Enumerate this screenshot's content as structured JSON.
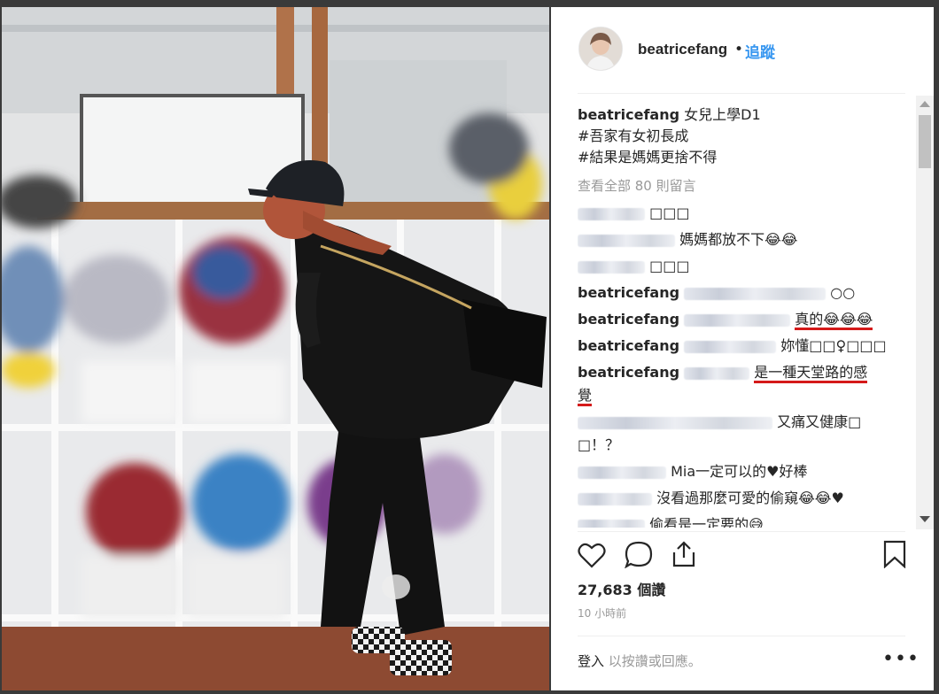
{
  "post": {
    "username": "beatricefang",
    "separator": "•",
    "follow_label": "追蹤",
    "caption_text": "女兒上學D1",
    "caption_tag1": "#吾家有女初長成",
    "caption_tag2": "#結果是媽媽更捨不得",
    "view_all": "查看全部 80 則留言",
    "likes": "27,683 個讚",
    "time": "10 小時前",
    "login_link": "登入",
    "login_text": " 以按讚或回應。",
    "more": "•••"
  },
  "comments": [
    {
      "user": "",
      "text": "□□□"
    },
    {
      "user": "",
      "text": "媽媽都放不下😂😂"
    },
    {
      "user": "",
      "text": "□□□"
    },
    {
      "user": "beatricefang",
      "text": "○○"
    },
    {
      "user": "beatricefang",
      "text": "真的😂😂😂"
    },
    {
      "user": "beatricefang",
      "text": "妳懂□□♀□□□"
    },
    {
      "user": "beatricefang",
      "text": "是一種天堂路的感"
    },
    {
      "user": "",
      "text": "覺"
    },
    {
      "user": "",
      "text": "又痛又健康□"
    },
    {
      "user": "",
      "text": "□！？"
    },
    {
      "user": "",
      "text": "Mia一定可以的♥好棒"
    },
    {
      "user": "",
      "text": "沒看過那麼可愛的偷窺😂😂♥"
    },
    {
      "user": "",
      "text": "偷看是一定要的😅"
    }
  ],
  "icons": [
    "heart-icon",
    "comment-icon",
    "share-icon",
    "bookmark-icon",
    "more-icon"
  ],
  "colors": {
    "follow": "#3897f0",
    "underline": "#d51a1a",
    "muted": "#999999"
  }
}
